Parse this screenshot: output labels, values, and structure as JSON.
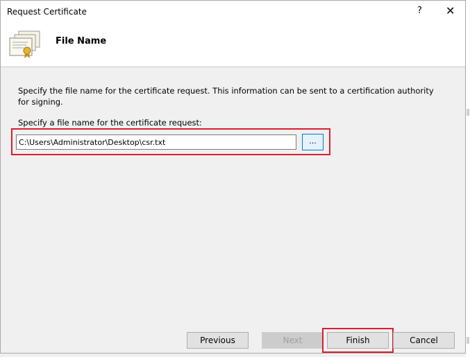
{
  "window": {
    "title": "Request Certificate",
    "help_glyph": "?",
    "close_glyph": "✕"
  },
  "header": {
    "title": "File Name",
    "icon": "certificate-icon"
  },
  "content": {
    "description": "Specify the file name for the certificate request. This information can be sent to a certification authority for signing.",
    "field_label": "Specify a file name for the certificate request:",
    "file_path": "C:\\Users\\Administrator\\Desktop\\csr.txt",
    "browse_label": "..."
  },
  "footer": {
    "previous_label": "Previous",
    "next_label": "Next",
    "finish_label": "Finish",
    "cancel_label": "Cancel"
  },
  "colors": {
    "highlight": "#d6202e",
    "accent": "#0078d7"
  }
}
